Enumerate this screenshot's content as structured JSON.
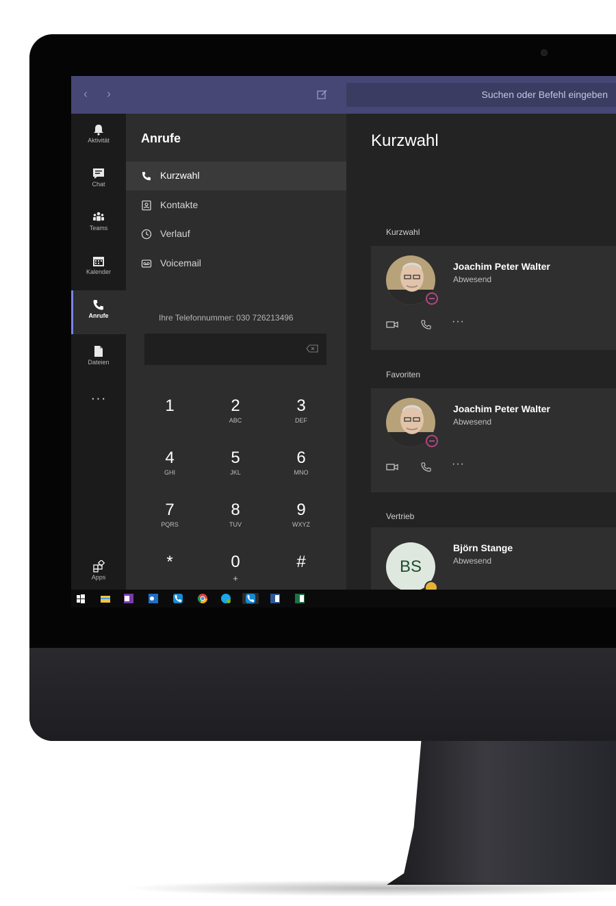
{
  "app": {
    "search_placeholder": "Suchen oder Befehl eingeben",
    "accent": "#464775"
  },
  "rail": {
    "items": [
      {
        "label": "Aktivität",
        "icon": "bell-icon"
      },
      {
        "label": "Chat",
        "icon": "chat-icon"
      },
      {
        "label": "Teams",
        "icon": "teams-icon"
      },
      {
        "label": "Kalender",
        "icon": "calendar-icon"
      },
      {
        "label": "Anrufe",
        "icon": "phone-icon"
      },
      {
        "label": "Dateien",
        "icon": "file-icon"
      }
    ],
    "more": "···",
    "apps_label": "Apps"
  },
  "calls": {
    "title": "Anrufe",
    "nav": [
      {
        "label": "Kurzwahl",
        "icon": "phone-icon"
      },
      {
        "label": "Kontakte",
        "icon": "contacts-icon"
      },
      {
        "label": "Verlauf",
        "icon": "clock-icon"
      },
      {
        "label": "Voicemail",
        "icon": "voicemail-icon"
      }
    ],
    "phone_number_text": "Ihre Telefonnummer: 030 726213496",
    "dial_value": "",
    "keypad": [
      {
        "n": "1",
        "l": ""
      },
      {
        "n": "2",
        "l": "ABC"
      },
      {
        "n": "3",
        "l": "DEF"
      },
      {
        "n": "4",
        "l": "GHI"
      },
      {
        "n": "5",
        "l": "JKL"
      },
      {
        "n": "6",
        "l": "MNO"
      },
      {
        "n": "7",
        "l": "PQRS"
      },
      {
        "n": "8",
        "l": "TUV"
      },
      {
        "n": "9",
        "l": "WXYZ"
      },
      {
        "n": "*",
        "l": ""
      },
      {
        "n": "0",
        "l": "+"
      },
      {
        "n": "#",
        "l": ""
      }
    ]
  },
  "main": {
    "title": "Kurzwahl",
    "sections": [
      {
        "label": "Kurzwahl",
        "contact": {
          "name": "Joachim Peter Walter",
          "status": "Abwesend"
        }
      },
      {
        "label": "Favoriten",
        "contact": {
          "name": "Joachim Peter Walter",
          "status": "Abwesend"
        }
      },
      {
        "label": "Vertrieb",
        "contact": {
          "name": "Björn Stange",
          "status": "Abwesend",
          "initials": "BS"
        }
      }
    ],
    "more_actions": "···"
  },
  "taskbar": {
    "icons": [
      "windows-icon",
      "explorer-icon",
      "onenote-icon",
      "outlook-icon",
      "phone-app-icon",
      "chrome-icon",
      "skype-icon",
      "phone-app-icon",
      "word-icon",
      "excel-icon"
    ]
  }
}
